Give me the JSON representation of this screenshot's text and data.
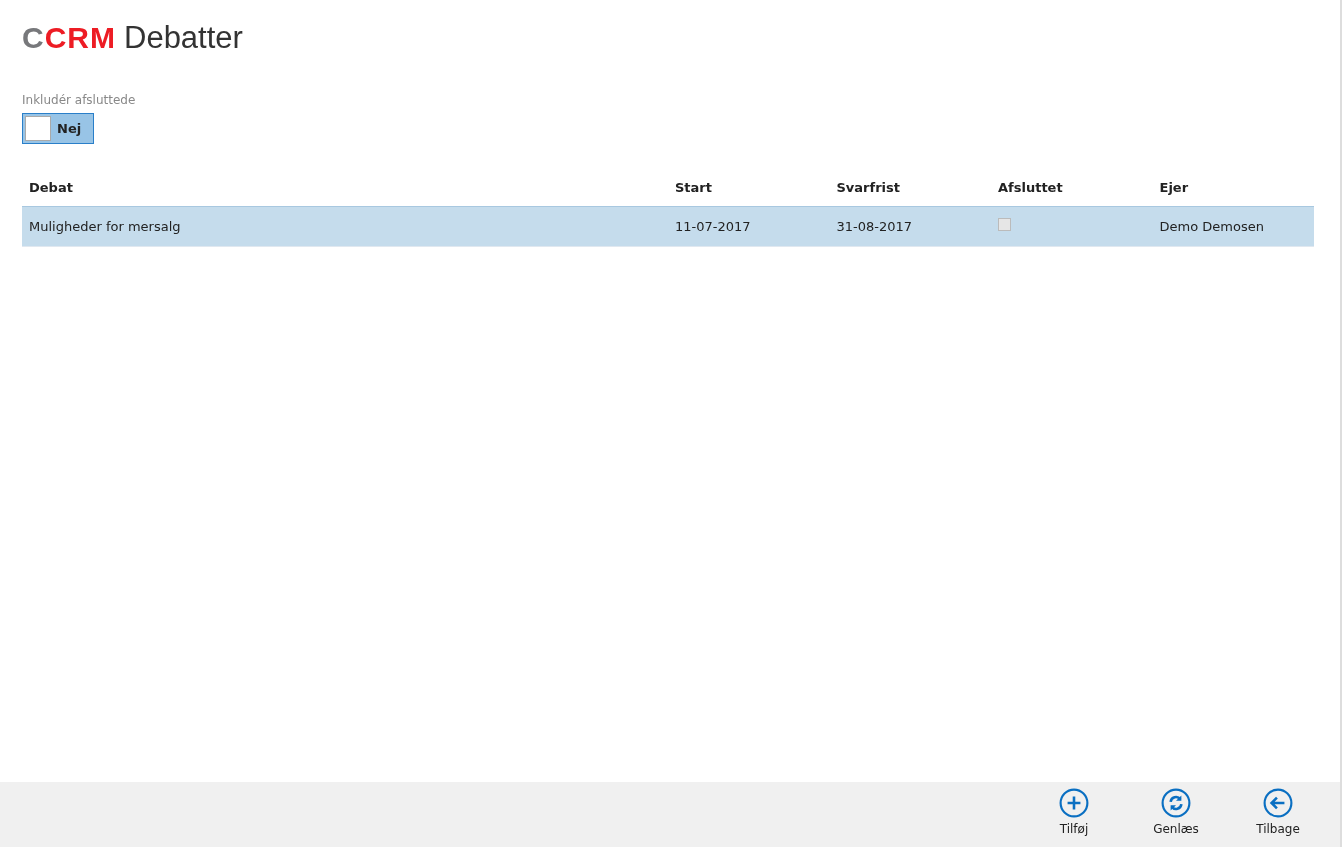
{
  "logo": [
    {
      "text": "C",
      "color": "#77787b"
    },
    {
      "text": "CRM",
      "color": "#ed1c24"
    }
  ],
  "title": "Debatter",
  "filter": {
    "label": "Inkludér afsluttede",
    "on": false,
    "value": "Nej"
  },
  "table": {
    "columns": [
      "Debat",
      "Start",
      "Svarfrist",
      "Afsluttet",
      "Ejer"
    ],
    "rows": [
      {
        "selected": true,
        "debat": "Muligheder for mersalg",
        "start": "11-07-2017",
        "svarfrist": "31-08-2017",
        "afsluttet": false,
        "ejer": "Demo Demosen"
      }
    ]
  },
  "toolbar": [
    {
      "kind": "add",
      "label": "Tilføj"
    },
    {
      "kind": "refresh",
      "label": "Genlæs"
    },
    {
      "kind": "back",
      "label": "Tilbage"
    }
  ]
}
